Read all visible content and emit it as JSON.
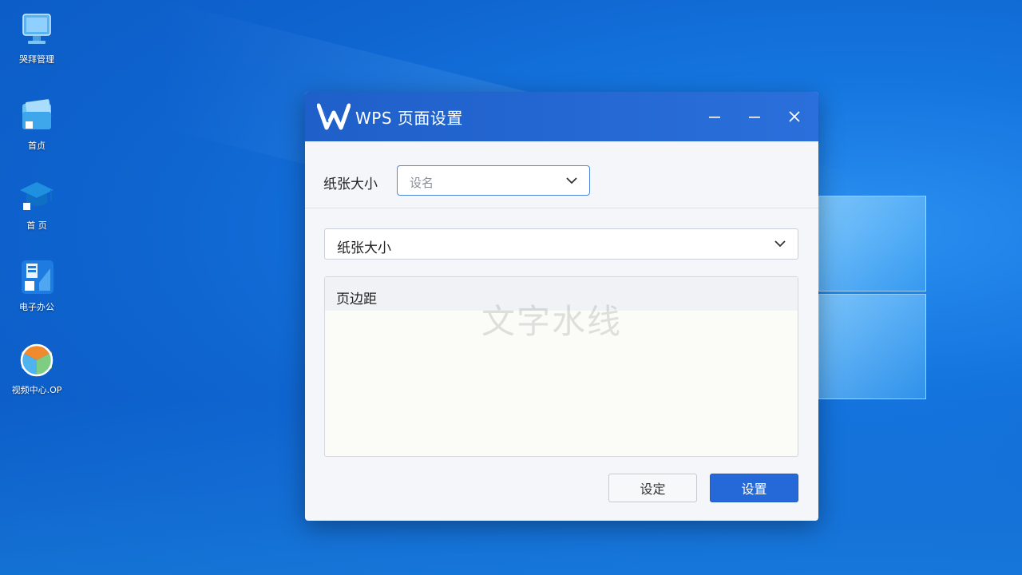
{
  "desktop": {
    "icons": [
      {
        "label": "哭拜管理",
        "icon": "computer-icon"
      },
      {
        "label": "首贞",
        "icon": "folder-icon"
      },
      {
        "label": "首 页",
        "icon": "graduation-cap-icon"
      },
      {
        "label": "电子办公",
        "icon": "office-app-icon"
      },
      {
        "label": "视频中心.OP",
        "icon": "cube-app-icon"
      }
    ]
  },
  "dialog": {
    "title": "WPS 页面设置",
    "controls": {
      "minimize": "–",
      "maximize": "–",
      "close": "✕"
    },
    "paper_size_label": "纸张大小",
    "paper_size_placeholder": "设名",
    "paper_select_value": "纸张大小",
    "margins_title": "页边距",
    "watermark_text": "文字水线",
    "buttons": {
      "set": "设定",
      "ok": "设置"
    }
  },
  "colors": {
    "titlebar": "#2366d6",
    "primary_button": "#2569d9",
    "desktop": "#0f64cf"
  }
}
